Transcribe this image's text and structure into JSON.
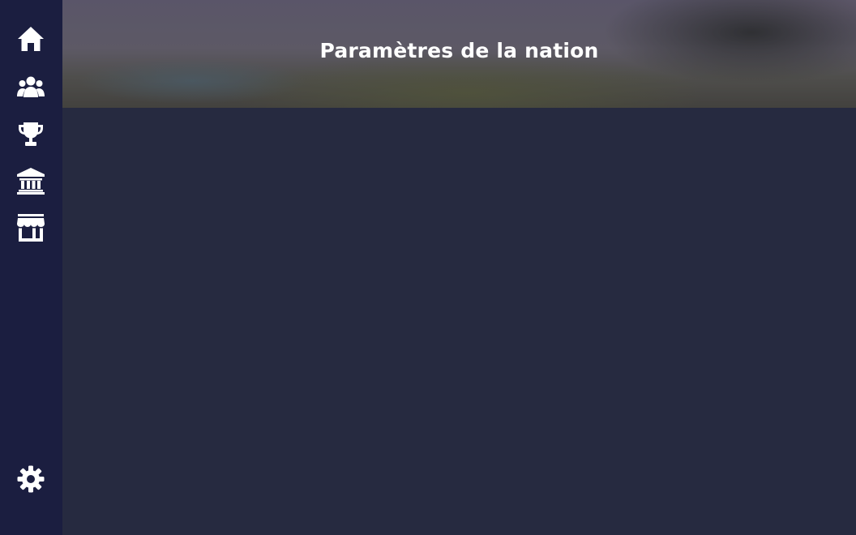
{
  "sidebar": {
    "items": [
      {
        "icon": "home-icon"
      },
      {
        "icon": "users-icon"
      },
      {
        "icon": "trophy-icon"
      },
      {
        "icon": "bank-icon"
      },
      {
        "icon": "store-icon"
      }
    ],
    "settings": {
      "icon": "gear-icon"
    }
  },
  "header": {
    "title": "Paramètres de la nation"
  },
  "colors": {
    "sidebar_bg": "#1b1e40",
    "main_bg": "#262a40",
    "icon": "#ffffff"
  }
}
